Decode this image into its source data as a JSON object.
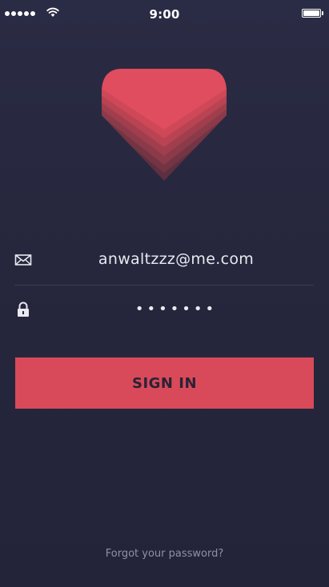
{
  "status_bar": {
    "time": "9:00",
    "signal_bars": 5,
    "wifi_icon": "wifi-icon",
    "battery_icon": "battery-icon"
  },
  "logo": {
    "icon": "heart-chevron-logo",
    "colors": [
      "#e04d5e",
      "#cf4858",
      "#b84352",
      "#a03e4d",
      "#8a3a49",
      "#733444",
      "#5e2f40"
    ]
  },
  "form": {
    "email": {
      "icon": "envelope-icon",
      "value": "anwaltzzz@me.com"
    },
    "password": {
      "icon": "lock-icon",
      "value": "•••••••"
    },
    "signin_label": "SIGN IN",
    "forgot_label": "Forgot your password?"
  },
  "colors": {
    "background": "#26273d",
    "accent": "#d84a5a",
    "button_text": "#2b2236",
    "muted_text": "#8f90a6",
    "divider": "#3b3c55"
  }
}
